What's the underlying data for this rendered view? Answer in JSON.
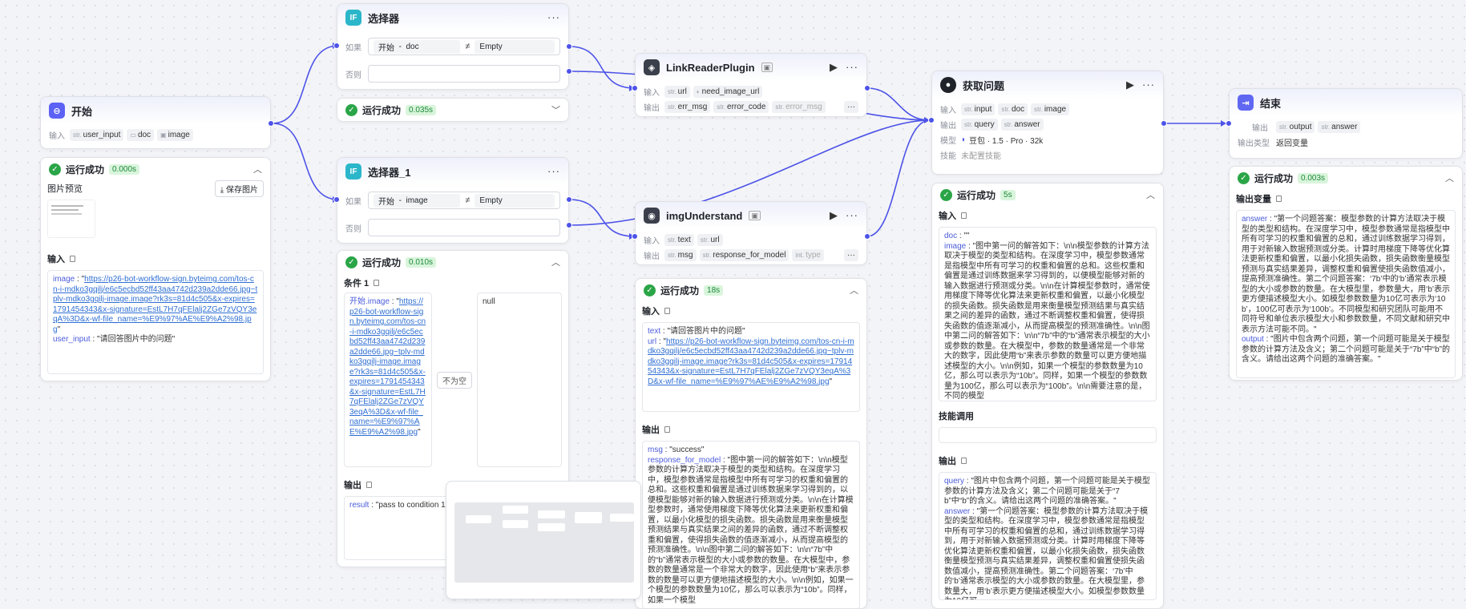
{
  "nodes": {
    "start": {
      "title": "开始",
      "input_label": "输入",
      "inputs": [
        {
          "type": "str.",
          "name": "user_input"
        },
        {
          "type": "doc-icon",
          "name": "doc"
        },
        {
          "type": "image-icon",
          "name": "image"
        }
      ],
      "status": "运行成功",
      "time": "0.000s",
      "image_preview": "图片预览",
      "save_image": "保存图片",
      "input_section": "输入",
      "image_key": "image",
      "image_value": "https://p26-bot-workflow-sign.byteimg.com/tos-cn-i-mdko3gqilj/e6c5ecbd52ff43aa4742d239a2dde66.jpg~tplv-mdko3gqilj-image.image?rk3s=81d4c505&x-expires=1791454343&x-signature=EstL7H7qFElalj2ZGe7zVQY3eqA%3D&x-wf-file_name=%E9%97%AE%E9%A2%98.jpg",
      "user_input_key": "user_input",
      "user_input_value": "请回答图片中的问题"
    },
    "selector1": {
      "title": "选择器",
      "if_label": "如果",
      "else_label": "否则",
      "cond_left": "开始",
      "cond_sep": "-",
      "cond_var": "doc",
      "cond_op": "≠",
      "cond_right": "Empty",
      "status": "运行成功",
      "time": "0.035s"
    },
    "selector2": {
      "title": "选择器_1",
      "if_label": "如果",
      "else_label": "否则",
      "cond_left": "开始",
      "cond_sep": "-",
      "cond_var": "image",
      "cond_op": "≠",
      "cond_right": "Empty",
      "status": "运行成功",
      "time": "0.010s",
      "condition_title": "条件 1",
      "left_key": "开始.image",
      "left_value": "https://p26-bot-workflow-sign.byteimg.com/tos-cn-i-mdko3gqilj/e6c5ecbd52ff43aa4742d239a2dde66.jpg~tplv-mdko3gqilj-image.image?rk3s=81d4c505&x-expires=1791454343&x-signature=EstL7H7qFElalj2ZGe7zVQY3eqA%3D&x-wf-file_name=%E9%97%AE%E9%A2%98.jpg",
      "op_label": "不为空",
      "right_value": "null",
      "output_section": "输出",
      "result_key": "result",
      "result_value": "pass to condition 1"
    },
    "linkreader": {
      "title": "LinkReaderPlugin",
      "input_label": "输入",
      "output_label": "输出",
      "inputs": [
        {
          "type": "str.",
          "name": "url"
        },
        {
          "type": "toggle",
          "name": "need_image_url"
        }
      ],
      "outputs": [
        {
          "type": "str.",
          "name": "err_msg"
        },
        {
          "type": "str.",
          "name": "error_code"
        },
        {
          "type": "str.",
          "name": "error_msg"
        }
      ]
    },
    "imgunderstand": {
      "title": "imgUnderstand",
      "input_label": "输入",
      "output_label": "输出",
      "inputs": [
        {
          "type": "str.",
          "name": "text"
        },
        {
          "type": "str.",
          "name": "url"
        }
      ],
      "outputs": [
        {
          "type": "str.",
          "name": "msg"
        },
        {
          "type": "str.",
          "name": "response_for_model"
        },
        {
          "type": "int.",
          "name": "type"
        }
      ],
      "status": "运行成功",
      "time": "18s",
      "input_section": "输入",
      "text_key": "text",
      "text_value": "请回答图片中的问题",
      "url_key": "url",
      "url_value": "https://p26-bot-workflow-sign.byteimg.com/tos-cn-i-mdko3gqilj/e6c5ecbd52ff43aa4742d239a2dde66.jpg~tplv-mdko3gqilj-image.image?rk3s=81d4c505&x-expires=1791454343&x-signature=EstL7H7qFElalj2ZGe7zVQY3eqA%3D&x-wf-file_name=%E9%97%AE%E9%A2%98.jpg",
      "output_section": "输出",
      "msg_key": "msg",
      "msg_value": "success",
      "rfm_key": "response_for_model",
      "rfm_value": "图中第一问的解答如下：\\n\\n模型参数的计算方法取决于模型的类型和结构。在深度学习中，模型参数通常是指模型中所有可学习的权重和偏置的总和。这些权重和偏置是通过训练数据来学习得到的，以便模型能够对新的输入数据进行预测或分类。\\n\\n在计算模型参数时，通常使用梯度下降等优化算法来更新权重和偏置，以最小化模型的损失函数。损失函数是用来衡量模型预测结果与真实结果之间的差异的函数，通过不断调整权重和偏置，使得损失函数的值逐渐减小，从而提高模型的预测准确性。\\n\\n图中第二问的解答如下：\\n\\n“7b”中的“b”通常表示模型的大小或参数的数量。在大模型中，参数的数量通常是一个非常大的数字，因此使用“b”来表示参数的数量可以更方便地描述模型的大小。\\n\\n例如，如果一个模型的参数数量为10亿，那么可以表示为“10b”。同样，如果一个模型"
    },
    "getq": {
      "title": "获取问题",
      "input_label": "输入",
      "output_label": "输出",
      "model_label": "模型",
      "skill_label": "技能",
      "inputs": [
        {
          "type": "str.",
          "name": "input"
        },
        {
          "type": "str.",
          "name": "doc"
        },
        {
          "type": "str.",
          "name": "image"
        }
      ],
      "outputs": [
        {
          "type": "str.",
          "name": "query"
        },
        {
          "type": "str.",
          "name": "answer"
        }
      ],
      "model_value": "豆包 · 1.5 · Pro · 32k",
      "skill_value": "未配置技能",
      "status": "运行成功",
      "time": "5s",
      "input_section": "输入",
      "doc_key": "doc",
      "doc_value": "\"\"",
      "image_key": "image",
      "image_value": "图中第一问的解答如下：\\n\\n模型参数的计算方法取决于模型的类型和结构。在深度学习中，模型参数通常是指模型中所有可学习的权重和偏置的总和。这些权重和偏置是通过训练数据来学习得到的，以便模型能够对新的输入数据进行预测或分类。\\n\\n在计算模型参数时，通常使用梯度下降等优化算法来更新权重和偏置，以最小化模型的损失函数。损失函数是用来衡量模型预测结果与真实结果之间的差异的函数，通过不断调整权重和偏置，使得损失函数的值逐渐减小，从而提高模型的预测准确性。\\n\\n图中第二问的解答如下：\\n\\n“7b”中的“b”通常表示模型的大小或参数的数量。在大模型中，参数的数量通常是一个非常大的数字，因此使用“b”来表示参数的数量可以更方便地描述模型的大小。\\n\\n例如，如果一个模型的参数数量为10亿，那么可以表示为“10b”。同样，如果一个模型的参数数量为100亿，那么可以表示为“100b”。\\n\\n需要注意的是，不同的模型",
      "skill_section": "技能调用",
      "output_section": "输出",
      "query_key": "query",
      "query_value": "图片中包含两个问题，第一个问题可能是关于模型参数的计算方法及含义；第二个问题可能是关于“7b”中“b”的含义。请给出这两个问题的准确答案。",
      "answer_key": "answer",
      "answer_value": "第一个问题答案：模型参数的计算方法取决于模型的类型和结构。在深度学习中，模型参数通常是指模型中所有可学习的权重和偏置的总和，通过训练数据学习得到，用于对新输入数据预测或分类。计算时用梯度下降等优化算法更新权重和偏置，以最小化损失函数，损失函数衡量模型预测与真实结果差异，调整权重和偏置使损失函数值减小，提高预测准确性。第二个问题答案：‘7b’中的‘b’通常表示模型的大小或参数的数量。在大模型里，参数量大，用‘b’表示更方便描述模型大小。如模型参数数量为10亿可"
    },
    "end": {
      "title": "结束",
      "output_label": "输出",
      "outputs": [
        {
          "type": "str.",
          "name": "output"
        },
        {
          "type": "str.",
          "name": "answer"
        }
      ],
      "output_type_label": "输出类型",
      "output_type_value": "返回变量",
      "status": "运行成功",
      "time": "0.003s",
      "var_section": "输出变量",
      "answer_key": "answer",
      "answer_value": "第一个问题答案：模型参数的计算方法取决于模型的类型和结构。在深度学习中，模型参数通常是指模型中所有可学习的权重和偏置的总和，通过训练数据学习得到，用于对新输入数据预测或分类。计算时用梯度下降等优化算法更新权重和偏置，以最小化损失函数，损失函数衡量模型预测与真实结果差异，调整权重和偏置使损失函数值减小，提高预测准确性。第二个问题答案：‘7b’中的‘b’通常表示模型的大小或参数的数量。在大模型里，参数量大，用‘b’表示更方便描述模型大小。如模型参数数量为10亿可表示为‘10b’，100亿可表示为‘100b’。不同模型和研究团队可能用不同符号和单位表示模型大小和参数数量，不同文献和研究中表示方法可能不同。",
      "output_key": "output",
      "output_value": "图片中包含两个问题，第一个问题可能是关于模型参数的计算方法及含义；第二个问题可能是关于“7b”中“b”的含义。请给出这两个问题的准确答案。"
    }
  },
  "colors": {
    "accent": "#4d53e8",
    "success": "#2aa547",
    "link": "#2f6fd3"
  }
}
